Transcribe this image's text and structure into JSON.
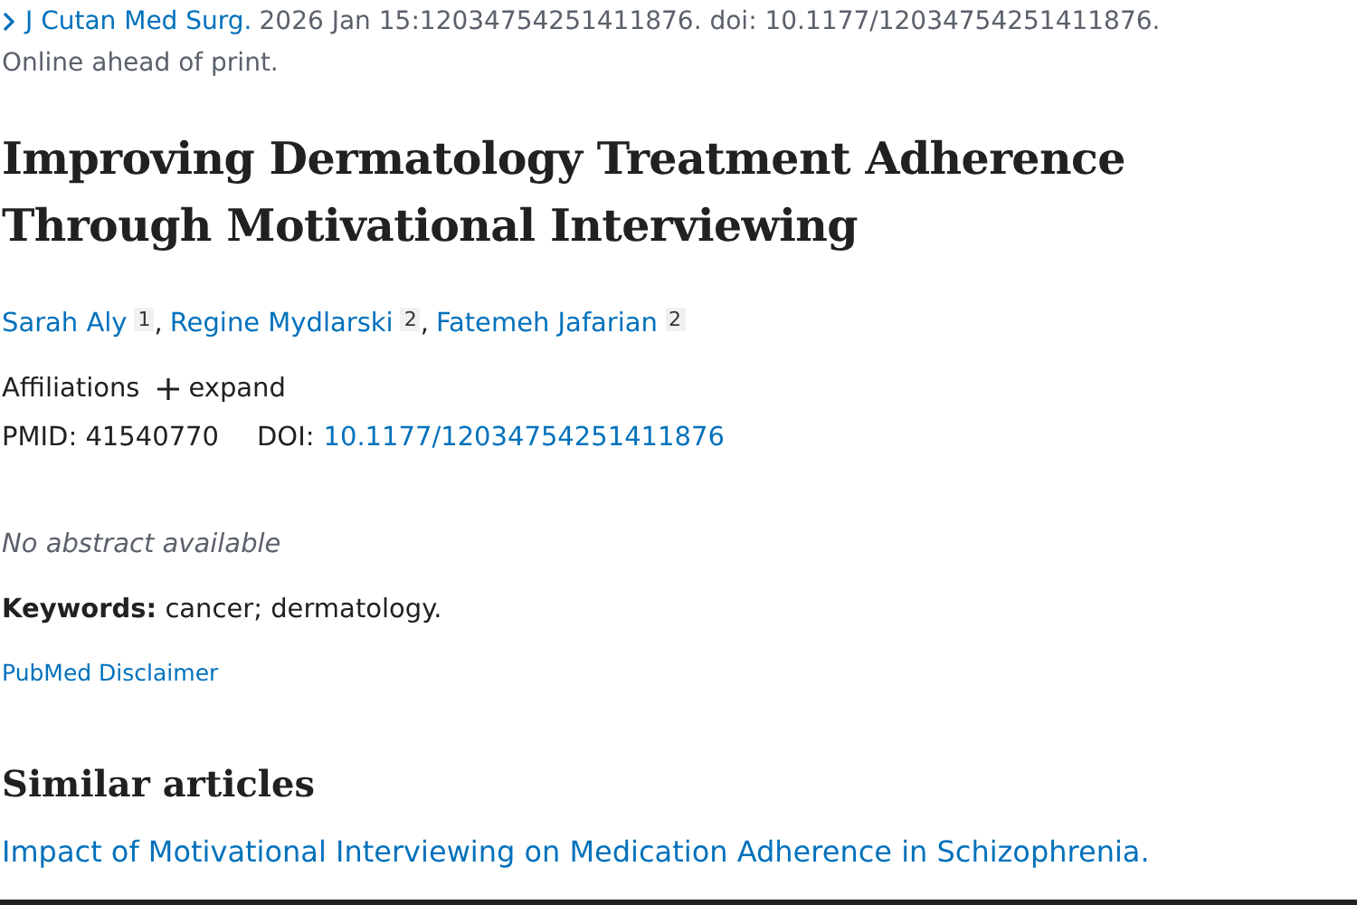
{
  "citation": {
    "journal": "J Cutan Med Surg.",
    "details": "2026 Jan 15:12034754251411876. doi: 10.1177/12034754251411876.",
    "status": "Online ahead of print."
  },
  "title": "Improving Dermatology Treatment Adherence Through Motivational Interviewing",
  "authors": [
    {
      "name": "Sarah Aly",
      "affiliation": "1",
      "separator": ","
    },
    {
      "name": "Regine Mydlarski",
      "affiliation": "2",
      "separator": ","
    },
    {
      "name": "Fatemeh Jafarian",
      "affiliation": "2"
    }
  ],
  "affiliations": {
    "label": "Affiliations",
    "toggle": "expand",
    "expanded": false
  },
  "identifiers": {
    "pmid_label": "PMID:",
    "pmid": "41540770",
    "doi_label": "DOI:",
    "doi": "10.1177/12034754251411876"
  },
  "abstract": "No abstract available",
  "keywords": "**Keywords:** cancer; dermatology.",
  "disclaimer": "PubMed Disclaimer",
  "similar_articles": {
    "heading": "Similar articles",
    "items": [
      "Impact of Motivational Interviewing on Medication Adherence in Schizophrenia."
    ]
  }
}
